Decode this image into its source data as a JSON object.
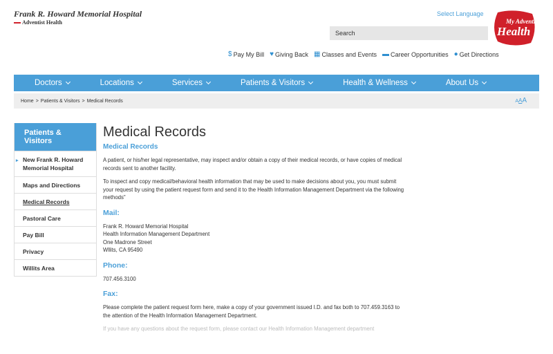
{
  "header": {
    "hospital_name": "Frank R. Howard Memorial Hospital",
    "parent_org": "Adventist Health",
    "select_language": "Select Language",
    "search_placeholder": "Search",
    "logo_text_top": "My Adventist",
    "logo_text_main": "Health"
  },
  "utility": [
    {
      "icon": "dollar-icon",
      "glyph": "$",
      "label": "Pay My Bill"
    },
    {
      "icon": "heart-icon",
      "glyph": "♥",
      "label": "Giving Back"
    },
    {
      "icon": "calendar-icon",
      "glyph": "▦",
      "label": "Classes and Events"
    },
    {
      "icon": "briefcase-icon",
      "glyph": "▬",
      "label": "Career Opportunities"
    },
    {
      "icon": "map-pin-icon",
      "glyph": "●",
      "label": "Get Directions"
    }
  ],
  "nav": [
    {
      "label": "Doctors"
    },
    {
      "label": "Locations"
    },
    {
      "label": "Services"
    },
    {
      "label": "Patients & Visitors"
    },
    {
      "label": "Health & Wellness"
    },
    {
      "label": "About Us"
    }
  ],
  "breadcrumb": {
    "home": "Home",
    "section": "Patients & Visitors",
    "current": "Medical Records",
    "sep": ">",
    "text_size": {
      "small": "A",
      "medium": "A",
      "large": "A"
    }
  },
  "sidebar": {
    "heading": "Patients & Visitors",
    "items": [
      {
        "label": "New Frank R. Howard Memorial Hospital"
      },
      {
        "label": "Maps and Directions"
      },
      {
        "label": "Medical Records"
      },
      {
        "label": "Pastoral Care"
      },
      {
        "label": "Pay Bill"
      },
      {
        "label": "Privacy"
      },
      {
        "label": "Willits Area"
      }
    ]
  },
  "main": {
    "title": "Medical Records",
    "subtitle": "Medical Records",
    "para1": "A patient, or his/her legal representative, may inspect and/or obtain a copy of their medical records, or have copies of medical records sent to another facility.",
    "para2": "To inspect and copy medical/behavioral health information that may be used to make decisions about you, you must submit your request by using the patient request form and send it to the Health Information Management Department via the following methods\"",
    "mail_heading": "Mail:",
    "mail_lines": [
      "Frank R. Howard Memorial Hospital",
      "Health Information Management Department",
      "One Madrone Street",
      "Wllits, CA 95490"
    ],
    "phone_heading": "Phone:",
    "phone": "707.456.3100",
    "fax_heading": "Fax:",
    "fax_text": "Please complete the patient request form here, make a copy of your government issued I.D. and fax both to 707.459.3163 to the attention of the Health Information Management Department.",
    "cutoff_text": "If you have any questions about the request form, please contact our Health Information Management department"
  },
  "colors": {
    "brand_blue": "#4a9fd8",
    "logo_red": "#d0202a"
  }
}
